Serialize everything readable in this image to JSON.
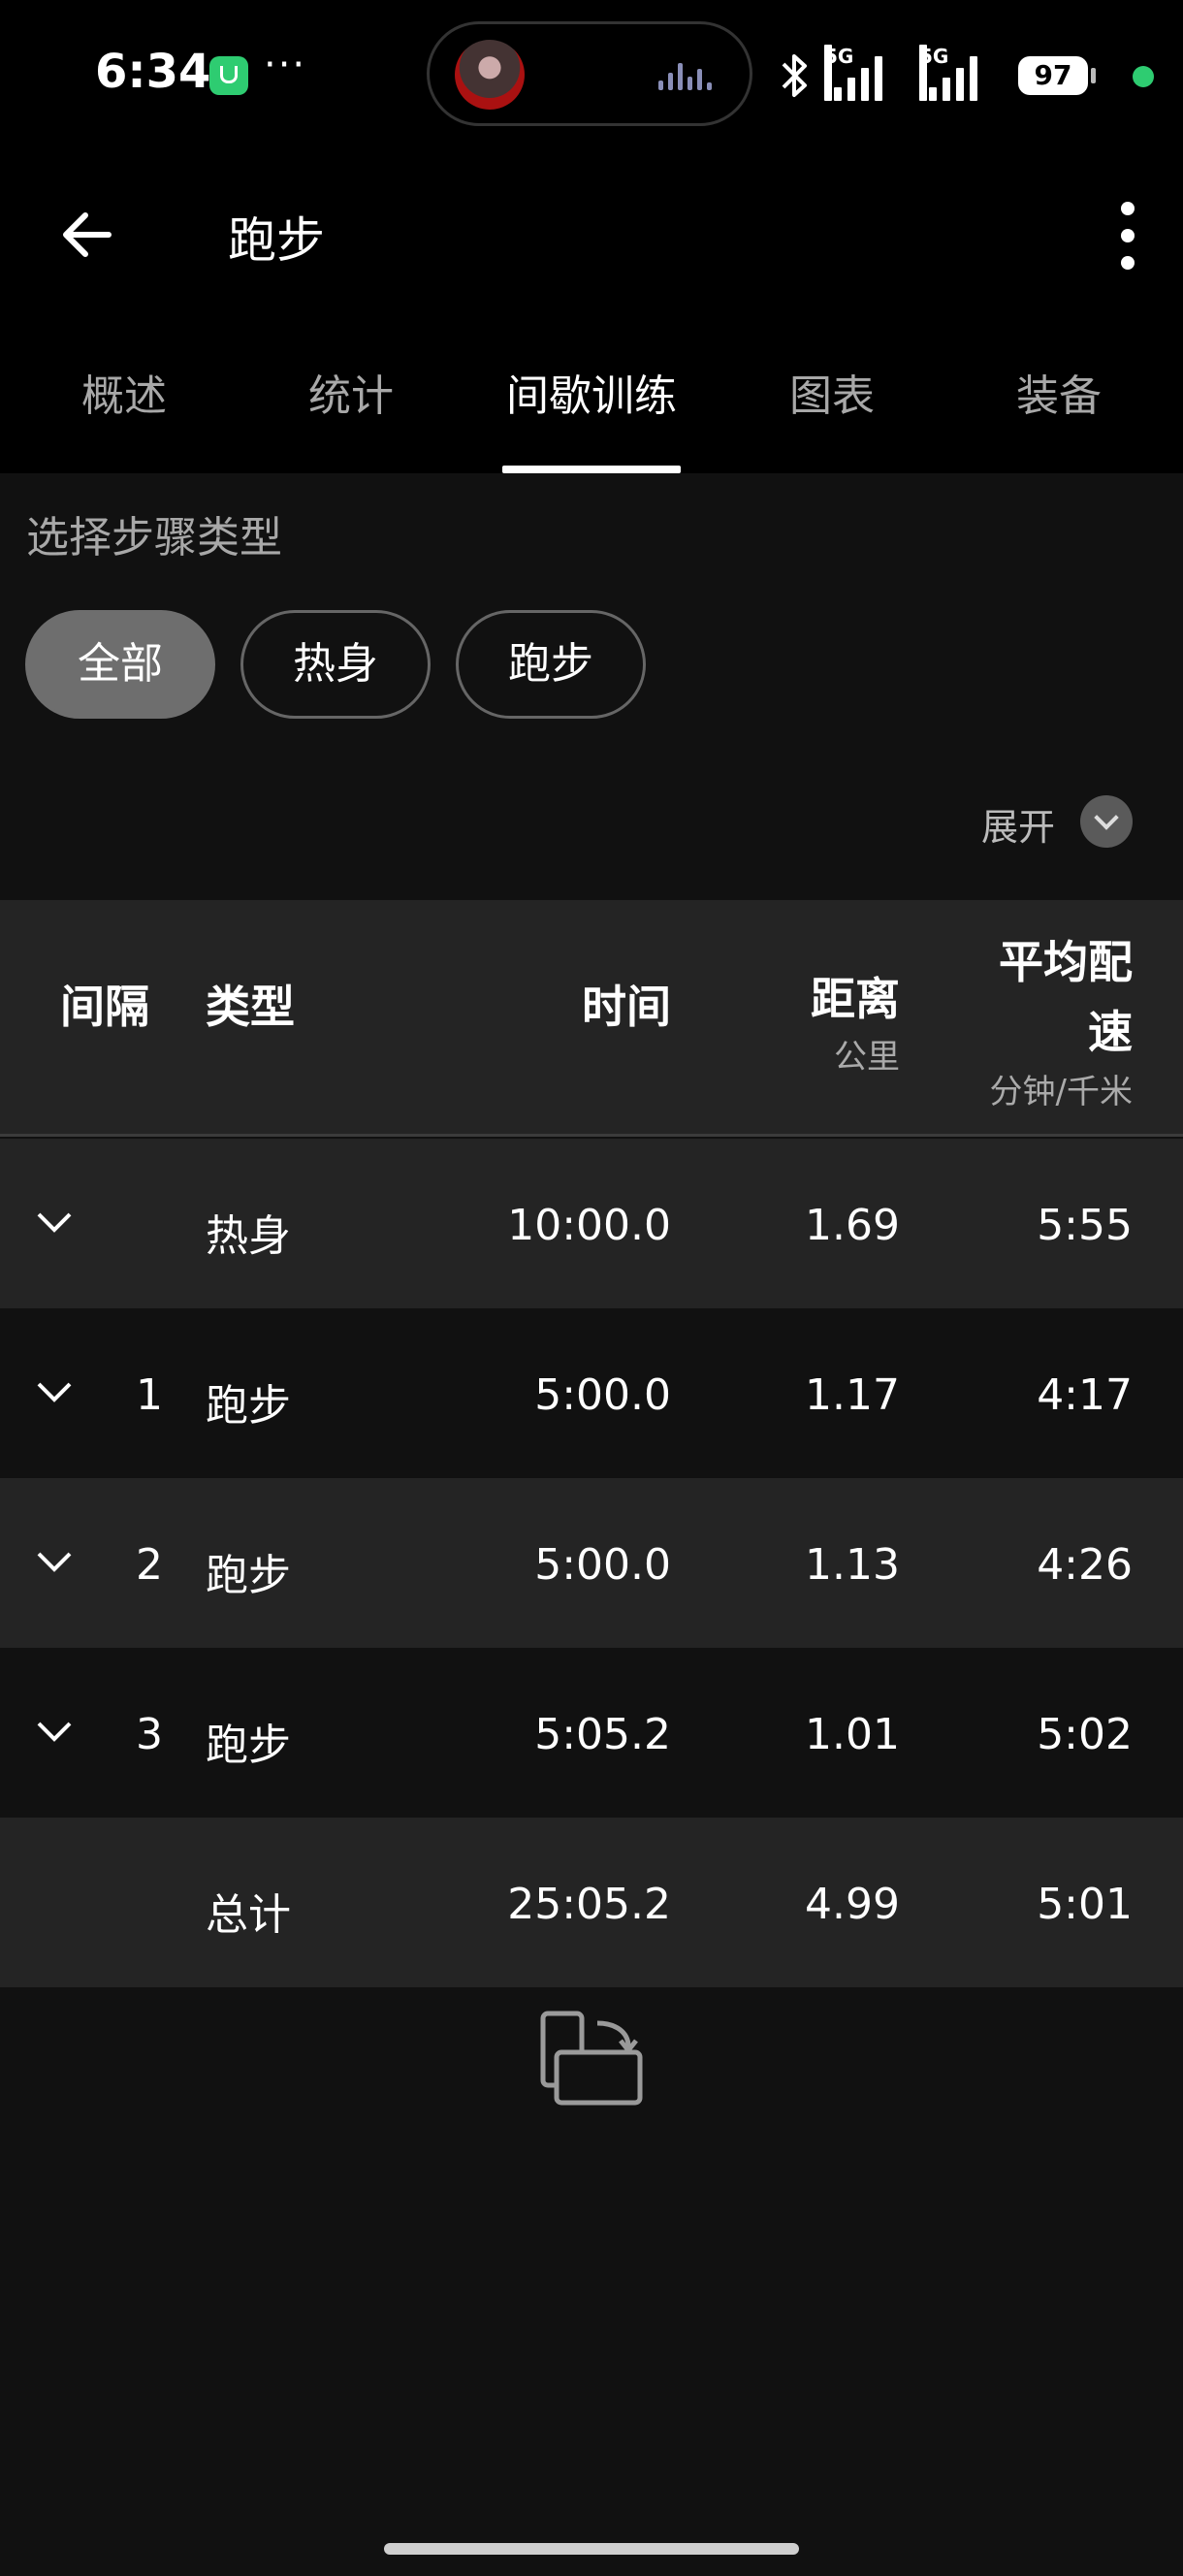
{
  "status_bar": {
    "time": "6:34",
    "more": "···",
    "sig1_label": "5G",
    "sig2_label": "5G",
    "battery": "97"
  },
  "app_bar": {
    "title": "跑步"
  },
  "tabs": [
    {
      "label": "概述"
    },
    {
      "label": "统计"
    },
    {
      "label": "间歇训练"
    },
    {
      "label": "图表"
    },
    {
      "label": "装备"
    }
  ],
  "filter": {
    "label": "选择步骤类型",
    "chips": [
      {
        "label": "全部"
      },
      {
        "label": "热身"
      },
      {
        "label": "跑步"
      }
    ]
  },
  "expand_label": "展开",
  "table": {
    "headers": {
      "interval": "间隔",
      "type": "类型",
      "time": "时间",
      "distance": "距离",
      "distance_unit": "公里",
      "pace_line1": "平均配",
      "pace_line2": "速",
      "pace_unit": "分钟/千米"
    },
    "rows": [
      {
        "interval": "",
        "type": "热身",
        "time": "10:00.0",
        "distance": "1.69",
        "pace": "5:55"
      },
      {
        "interval": "1",
        "type": "跑步",
        "time": "5:00.0",
        "distance": "1.17",
        "pace": "4:17"
      },
      {
        "interval": "2",
        "type": "跑步",
        "time": "5:00.0",
        "distance": "1.13",
        "pace": "4:26"
      },
      {
        "interval": "3",
        "type": "跑步",
        "time": "5:05.2",
        "distance": "1.01",
        "pace": "5:02"
      }
    ],
    "total": {
      "label": "总计",
      "time": "25:05.2",
      "distance": "4.99",
      "pace": "5:01"
    }
  }
}
